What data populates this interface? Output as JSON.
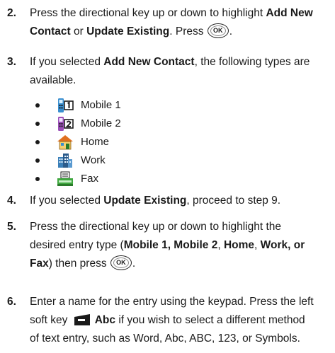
{
  "steps": [
    {
      "num": "2.",
      "line1_a": "Press the directional key up or down to highlight ",
      "line1_b": "Add New",
      "line2_a": "Contact",
      "line2_b": " or ",
      "line2_c": "Update Existing",
      "line2_d": ". Press "
    },
    {
      "num": "3.",
      "line1_a": "If you selected ",
      "line1_b": "Add New Contact",
      "line1_c": ", the following types are",
      "line2": "available."
    },
    {
      "num": "4.",
      "line1_a": "If you selected ",
      "line1_b": "Update Existing",
      "line1_c": ", proceed to step 9."
    },
    {
      "num": "5.",
      "line1": "Press the directional key up or down to highlight the",
      "line2_a": "desired entry type (",
      "line2_b": "Mobile 1, Mobile 2",
      "line2_c": ", ",
      "line2_d": "Home",
      "line2_e": ", ",
      "line2_f": "Work, or",
      "line3_a": "Fax",
      "line3_b": ") then press "
    },
    {
      "num": "6.",
      "line1": "Enter a name for the entry using the keypad. Press the left",
      "line2_a": "soft key ",
      "line2_b": "Abc",
      "line2_c": " if you wish to select a different method",
      "line3": "of text entry, such as Word, Abc, ABC, 123, or Symbols."
    }
  ],
  "ok_button_label": "OK",
  "entry_types": [
    {
      "label": "Mobile 1",
      "icon": "mobile-1-icon"
    },
    {
      "label": "Mobile 2",
      "icon": "mobile-2-icon"
    },
    {
      "label": "Home",
      "icon": "home-icon"
    },
    {
      "label": "Work",
      "icon": "work-icon"
    },
    {
      "label": "Fax",
      "icon": "fax-icon"
    }
  ]
}
